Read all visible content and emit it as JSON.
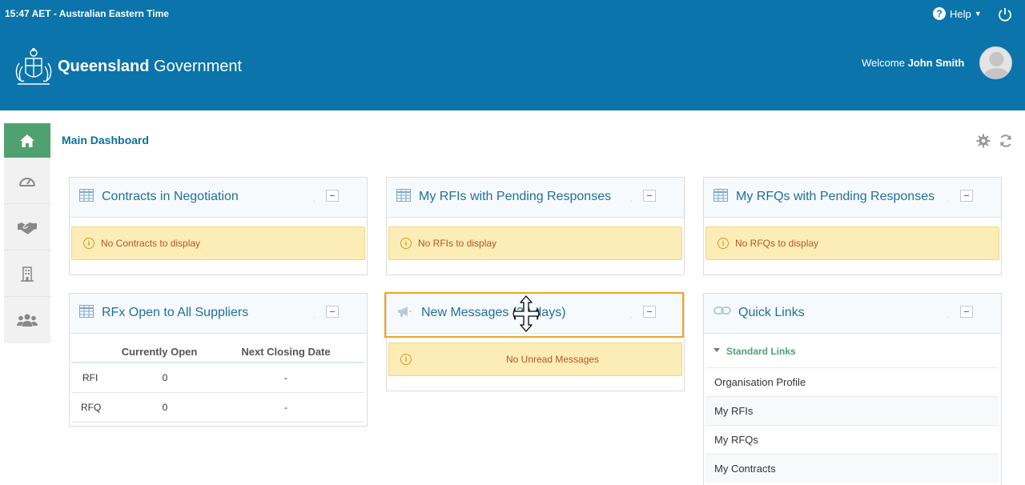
{
  "header": {
    "time": "15:47 AET - Australian Eastern Time",
    "help_label": "Help",
    "help_icon": "question-circle-icon",
    "power_icon": "power-icon",
    "brand_bold": "Queensland",
    "brand_rest": " Government",
    "welcome_prefix": "Welcome ",
    "user_name": "John Smith"
  },
  "sidebar": {
    "items": [
      {
        "icon": "home-icon"
      },
      {
        "icon": "dashboard-gauge-icon"
      },
      {
        "icon": "handshake-icon"
      },
      {
        "icon": "building-icon"
      },
      {
        "icon": "users-icon"
      }
    ]
  },
  "page": {
    "title": "Main Dashboard"
  },
  "panels": {
    "contracts": {
      "title": "Contracts in Negotiation",
      "message": "No Contracts to display"
    },
    "rfis": {
      "title": "My RFIs with Pending Responses",
      "message": "No RFIs to display"
    },
    "rfqs": {
      "title": "My RFQs with Pending Responses",
      "message": "No RFQs to display"
    },
    "rfx": {
      "title": "RFx Open to All Suppliers",
      "columns": [
        "",
        "Currently Open",
        "Next Closing Date"
      ],
      "rows": [
        {
          "type": "RFI",
          "open": "0",
          "closing": "-"
        },
        {
          "type": "RFQ",
          "open": "0",
          "closing": "-"
        }
      ]
    },
    "messages": {
      "title": "New Messages (30 days)",
      "message": "No Unread Messages"
    },
    "quick_links": {
      "title": "Quick Links",
      "group": "Standard Links",
      "items": [
        "Organisation Profile",
        "My RFIs",
        "My RFQs",
        "My Contracts"
      ]
    }
  },
  "colors": {
    "header_bg": "#0a74ab",
    "home_active": "#4fa26f",
    "title_blue": "#1f6f9e",
    "alert_bg": "#fcedb7",
    "alert_text": "#b5561d",
    "highlight": "#f0a51f"
  }
}
